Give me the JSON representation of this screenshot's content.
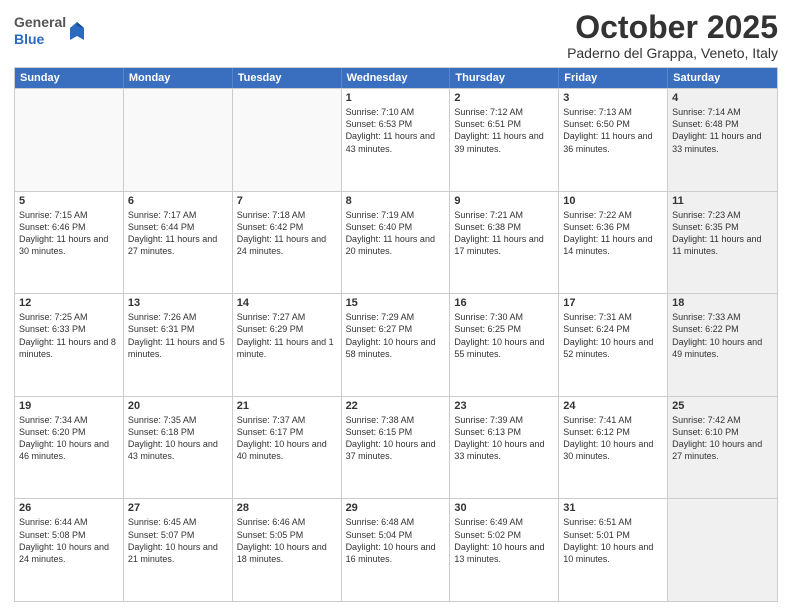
{
  "logo": {
    "general": "General",
    "blue": "Blue"
  },
  "header": {
    "month": "October 2025",
    "location": "Paderno del Grappa, Veneto, Italy"
  },
  "weekdays": [
    "Sunday",
    "Monday",
    "Tuesday",
    "Wednesday",
    "Thursday",
    "Friday",
    "Saturday"
  ],
  "rows": [
    [
      {
        "day": "",
        "text": "",
        "empty": true
      },
      {
        "day": "",
        "text": "",
        "empty": true
      },
      {
        "day": "",
        "text": "",
        "empty": true
      },
      {
        "day": "1",
        "text": "Sunrise: 7:10 AM\nSunset: 6:53 PM\nDaylight: 11 hours and 43 minutes."
      },
      {
        "day": "2",
        "text": "Sunrise: 7:12 AM\nSunset: 6:51 PM\nDaylight: 11 hours and 39 minutes."
      },
      {
        "day": "3",
        "text": "Sunrise: 7:13 AM\nSunset: 6:50 PM\nDaylight: 11 hours and 36 minutes."
      },
      {
        "day": "4",
        "text": "Sunrise: 7:14 AM\nSunset: 6:48 PM\nDaylight: 11 hours and 33 minutes.",
        "shaded": true
      }
    ],
    [
      {
        "day": "5",
        "text": "Sunrise: 7:15 AM\nSunset: 6:46 PM\nDaylight: 11 hours and 30 minutes."
      },
      {
        "day": "6",
        "text": "Sunrise: 7:17 AM\nSunset: 6:44 PM\nDaylight: 11 hours and 27 minutes."
      },
      {
        "day": "7",
        "text": "Sunrise: 7:18 AM\nSunset: 6:42 PM\nDaylight: 11 hours and 24 minutes."
      },
      {
        "day": "8",
        "text": "Sunrise: 7:19 AM\nSunset: 6:40 PM\nDaylight: 11 hours and 20 minutes."
      },
      {
        "day": "9",
        "text": "Sunrise: 7:21 AM\nSunset: 6:38 PM\nDaylight: 11 hours and 17 minutes."
      },
      {
        "day": "10",
        "text": "Sunrise: 7:22 AM\nSunset: 6:36 PM\nDaylight: 11 hours and 14 minutes."
      },
      {
        "day": "11",
        "text": "Sunrise: 7:23 AM\nSunset: 6:35 PM\nDaylight: 11 hours and 11 minutes.",
        "shaded": true
      }
    ],
    [
      {
        "day": "12",
        "text": "Sunrise: 7:25 AM\nSunset: 6:33 PM\nDaylight: 11 hours and 8 minutes."
      },
      {
        "day": "13",
        "text": "Sunrise: 7:26 AM\nSunset: 6:31 PM\nDaylight: 11 hours and 5 minutes."
      },
      {
        "day": "14",
        "text": "Sunrise: 7:27 AM\nSunset: 6:29 PM\nDaylight: 11 hours and 1 minute."
      },
      {
        "day": "15",
        "text": "Sunrise: 7:29 AM\nSunset: 6:27 PM\nDaylight: 10 hours and 58 minutes."
      },
      {
        "day": "16",
        "text": "Sunrise: 7:30 AM\nSunset: 6:25 PM\nDaylight: 10 hours and 55 minutes."
      },
      {
        "day": "17",
        "text": "Sunrise: 7:31 AM\nSunset: 6:24 PM\nDaylight: 10 hours and 52 minutes."
      },
      {
        "day": "18",
        "text": "Sunrise: 7:33 AM\nSunset: 6:22 PM\nDaylight: 10 hours and 49 minutes.",
        "shaded": true
      }
    ],
    [
      {
        "day": "19",
        "text": "Sunrise: 7:34 AM\nSunset: 6:20 PM\nDaylight: 10 hours and 46 minutes."
      },
      {
        "day": "20",
        "text": "Sunrise: 7:35 AM\nSunset: 6:18 PM\nDaylight: 10 hours and 43 minutes."
      },
      {
        "day": "21",
        "text": "Sunrise: 7:37 AM\nSunset: 6:17 PM\nDaylight: 10 hours and 40 minutes."
      },
      {
        "day": "22",
        "text": "Sunrise: 7:38 AM\nSunset: 6:15 PM\nDaylight: 10 hours and 37 minutes."
      },
      {
        "day": "23",
        "text": "Sunrise: 7:39 AM\nSunset: 6:13 PM\nDaylight: 10 hours and 33 minutes."
      },
      {
        "day": "24",
        "text": "Sunrise: 7:41 AM\nSunset: 6:12 PM\nDaylight: 10 hours and 30 minutes."
      },
      {
        "day": "25",
        "text": "Sunrise: 7:42 AM\nSunset: 6:10 PM\nDaylight: 10 hours and 27 minutes.",
        "shaded": true
      }
    ],
    [
      {
        "day": "26",
        "text": "Sunrise: 6:44 AM\nSunset: 5:08 PM\nDaylight: 10 hours and 24 minutes."
      },
      {
        "day": "27",
        "text": "Sunrise: 6:45 AM\nSunset: 5:07 PM\nDaylight: 10 hours and 21 minutes."
      },
      {
        "day": "28",
        "text": "Sunrise: 6:46 AM\nSunset: 5:05 PM\nDaylight: 10 hours and 18 minutes."
      },
      {
        "day": "29",
        "text": "Sunrise: 6:48 AM\nSunset: 5:04 PM\nDaylight: 10 hours and 16 minutes."
      },
      {
        "day": "30",
        "text": "Sunrise: 6:49 AM\nSunset: 5:02 PM\nDaylight: 10 hours and 13 minutes."
      },
      {
        "day": "31",
        "text": "Sunrise: 6:51 AM\nSunset: 5:01 PM\nDaylight: 10 hours and 10 minutes."
      },
      {
        "day": "",
        "text": "",
        "empty": true,
        "shaded": true
      }
    ]
  ]
}
